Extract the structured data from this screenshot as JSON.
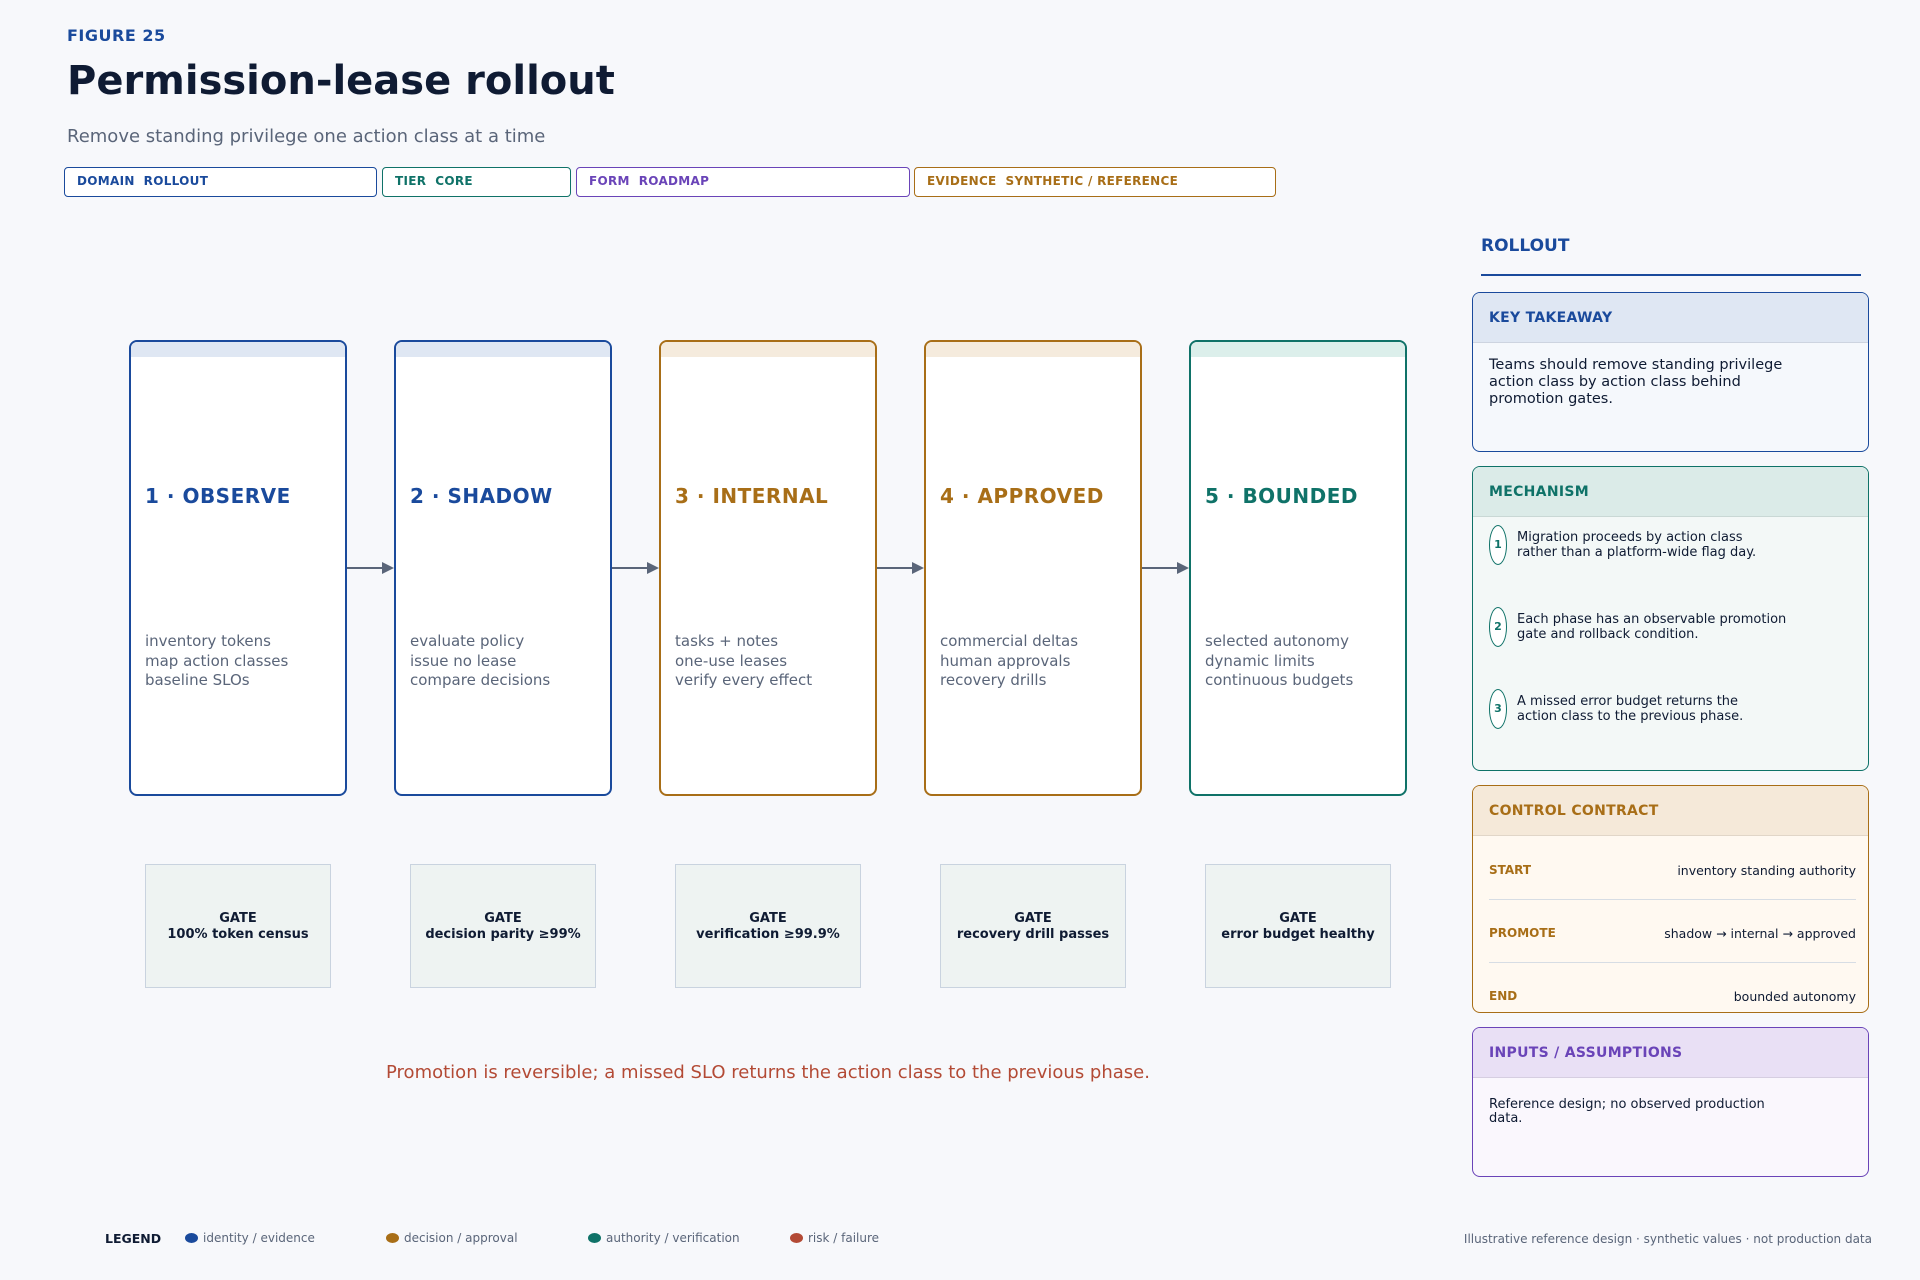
{
  "header": {
    "figure_label": "FIGURE 25",
    "title": "Permission-lease rollout",
    "subtitle": "Remove standing privilege one action class at a time"
  },
  "tags": [
    {
      "text": "DOMAIN  ROLLOUT",
      "color": "#1a4a9c"
    },
    {
      "text": "TIER  CORE",
      "color": "#0f7268"
    },
    {
      "text": "FORM  ROADMAP",
      "color": "#6a44b8"
    },
    {
      "text": "EVIDENCE  SYNTHETIC / REFERENCE",
      "color": "#a86e17"
    }
  ],
  "phases": [
    {
      "title": "1 · OBSERVE",
      "color": "#1a4a9c",
      "band": "#dfe7f3",
      "lines": [
        "inventory tokens",
        "map action classes",
        "baseline SLOs"
      ],
      "gate_label": "GATE",
      "gate_value": "100% token census"
    },
    {
      "title": "2 · SHADOW",
      "color": "#1a4a9c",
      "band": "#dfe7f3",
      "lines": [
        "evaluate policy",
        "issue no lease",
        "compare decisions"
      ],
      "gate_label": "GATE",
      "gate_value": "decision parity ≥99%"
    },
    {
      "title": "3 · INTERNAL",
      "color": "#a86e17",
      "band": "#f5ebdd",
      "lines": [
        "tasks + notes",
        "one-use leases",
        "verify every effect"
      ],
      "gate_label": "GATE",
      "gate_value": "verification ≥99.9%"
    },
    {
      "title": "4 · APPROVED",
      "color": "#a86e17",
      "band": "#f5ebdd",
      "lines": [
        "commercial deltas",
        "human approvals",
        "recovery drills"
      ],
      "gate_label": "GATE",
      "gate_value": "recovery drill passes"
    },
    {
      "title": "5 · BOUNDED",
      "color": "#0f7268",
      "band": "#dcefeb",
      "lines": [
        "selected autonomy",
        "dynamic limits",
        "continuous budgets"
      ],
      "gate_label": "GATE",
      "gate_value": "error budget healthy"
    }
  ],
  "footnote": "Promotion is reversible; a missed SLO returns the action class to the previous phase.",
  "sidebar": {
    "heading": "ROLLOUT",
    "takeaway": {
      "title": "KEY TAKEAWAY",
      "lines": [
        "Teams should remove standing privilege",
        "action class by action class behind",
        "promotion gates."
      ]
    },
    "mechanism": {
      "title": "MECHANISM",
      "steps": [
        {
          "num": "1",
          "lines": [
            "Migration proceeds by action class",
            "rather than a platform-wide flag day."
          ]
        },
        {
          "num": "2",
          "lines": [
            "Each phase has an observable promotion",
            "gate and rollback condition."
          ]
        },
        {
          "num": "3",
          "lines": [
            "A missed error budget returns the",
            "action class to the previous phase."
          ]
        }
      ]
    },
    "contract": {
      "title": "CONTROL CONTRACT",
      "rows": [
        {
          "key": "START",
          "value": "inventory standing authority"
        },
        {
          "key": "PROMOTE",
          "value": "shadow → internal → approved"
        },
        {
          "key": "END",
          "value": "bounded autonomy"
        }
      ]
    },
    "inputs": {
      "title": "INPUTS / ASSUMPTIONS",
      "lines": [
        "Reference design; no observed production",
        "data."
      ]
    }
  },
  "legend": {
    "title": "LEGEND",
    "items": [
      {
        "label": "identity / evidence",
        "color": "#1a4a9c"
      },
      {
        "label": "decision / approval",
        "color": "#a86e17"
      },
      {
        "label": "authority / verification",
        "color": "#0f7268"
      },
      {
        "label": "risk / failure",
        "color": "#b34a35"
      }
    ]
  },
  "disclaimer": "Illustrative reference design · synthetic values · not production data"
}
